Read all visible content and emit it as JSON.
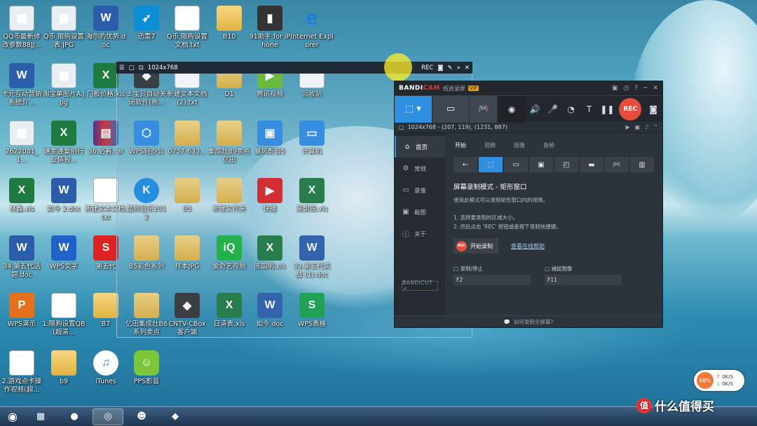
{
  "desktop": {
    "icons": [
      {
        "label": "QQ币最新修改参数88JJ...",
        "kind": "img",
        "glyph": "▦"
      },
      {
        "label": "Q币 限购设置表.JPG",
        "kind": "img",
        "glyph": "▦"
      },
      {
        "label": "海尔的优势.doc",
        "kind": "word",
        "glyph": "W"
      },
      {
        "label": "迅雷7",
        "kind": "bird",
        "glyph": "➶"
      },
      {
        "label": "Q币 限购设置文档.txt",
        "kind": "txt",
        "glyph": ""
      },
      {
        "label": "B10",
        "kind": "folder",
        "glyph": ""
      },
      {
        "label": "91助手 for iPhone",
        "kind": "app",
        "glyph": "▮"
      },
      {
        "label": "Internet Explorer",
        "kind": "ie",
        "glyph": "e"
      },
      {
        "label": "卡元互动营销系统介...",
        "kind": "word",
        "glyph": "W"
      },
      {
        "label": "淘宝单图片A.jpg",
        "kind": "img",
        "glyph": "▦"
      },
      {
        "label": "门板价格.xls",
        "kind": "excel",
        "glyph": "X"
      },
      {
        "label": "3.宝贝自动关闭软件(高...",
        "kind": "app",
        "glyph": "◆"
      },
      {
        "label": "新建文本文档 (2).txt",
        "kind": "txt",
        "glyph": ""
      },
      {
        "label": "D1",
        "kind": "folder",
        "glyph": ""
      },
      {
        "label": "腾讯视频",
        "kind": "green",
        "glyph": "▶"
      },
      {
        "label": "回收站",
        "kind": "txt",
        "glyph": "♻"
      },
      {
        "label": "2622081_1...",
        "kind": "img",
        "glyph": "▦"
      },
      {
        "label": "速卖通案例行业情报...",
        "kind": "excel",
        "glyph": "X"
      },
      {
        "label": "36.必看.rar",
        "kind": "rar",
        "glyph": "▤"
      },
      {
        "label": "WPS轻办公",
        "kind": "blue",
        "glyph": "⬡"
      },
      {
        "label": "0757-633...",
        "kind": "folder",
        "glyph": ""
      },
      {
        "label": "集成灶B9卖点亿田",
        "kind": "folder",
        "glyph": ""
      },
      {
        "label": "暴风影音5",
        "kind": "blue",
        "glyph": "▣"
      },
      {
        "label": "计算机",
        "kind": "blue",
        "glyph": "▭"
      },
      {
        "label": "林鑫.xls",
        "kind": "excel",
        "glyph": "X"
      },
      {
        "label": "如今 2.doc",
        "kind": "word",
        "glyph": "W"
      },
      {
        "label": "新建文本文档.txt",
        "kind": "txt",
        "glyph": ""
      },
      {
        "label": "酷狗音乐2012",
        "kind": "kugou",
        "glyph": "K"
      },
      {
        "label": "B5",
        "kind": "folder",
        "glyph": ""
      },
      {
        "label": "新建文件夹",
        "kind": "folder",
        "glyph": ""
      },
      {
        "label": "快播",
        "kind": "red",
        "glyph": "▶"
      },
      {
        "label": "吴朝锐.xls",
        "kind": "excel",
        "glyph": "X"
      },
      {
        "label": "34.第五代话题.doc",
        "kind": "word",
        "glyph": "W"
      },
      {
        "label": "WPS文字",
        "kind": "wps-w",
        "glyph": "W"
      },
      {
        "label": "第五代",
        "kind": "red",
        "glyph": "S"
      },
      {
        "label": "B5彩色系列",
        "kind": "folder",
        "glyph": ""
      },
      {
        "label": "样本JPG",
        "kind": "folder",
        "glyph": ""
      },
      {
        "label": "爱奇艺视频",
        "kind": "qiyi",
        "glyph": "iQ"
      },
      {
        "label": "陈国明.xls",
        "kind": "excel",
        "glyph": "X"
      },
      {
        "label": "33.第五代实战 (1).doc",
        "kind": "word",
        "glyph": "W"
      },
      {
        "label": "WPS演示",
        "kind": "wps-p",
        "glyph": "P"
      },
      {
        "label": "1.限购设置QB(超清...",
        "kind": "txt",
        "glyph": ""
      },
      {
        "label": "B7",
        "kind": "folder",
        "glyph": ""
      },
      {
        "label": "亿田集成灶B6系列卖点",
        "kind": "folder",
        "glyph": ""
      },
      {
        "label": "CNTV-CBox客户端",
        "kind": "app",
        "glyph": "◆"
      },
      {
        "label": "日清表.xls",
        "kind": "excel",
        "glyph": "X"
      },
      {
        "label": "如今.doc",
        "kind": "word",
        "glyph": "W"
      },
      {
        "label": "WPS表格",
        "kind": "wps-s",
        "glyph": "S"
      },
      {
        "label": "2.游戏点卡操作视频(超...",
        "kind": "txt",
        "glyph": ""
      },
      {
        "label": "b9",
        "kind": "folder",
        "glyph": ""
      },
      {
        "label": "iTunes",
        "kind": "itunes",
        "glyph": "♫"
      },
      {
        "label": "PPS影音",
        "kind": "pps",
        "glyph": "☺"
      }
    ]
  },
  "selection": {
    "size_label": "1024x768",
    "rec_label": "REC"
  },
  "bandicam": {
    "logo_main": "BANDI",
    "logo_accent": "CAM",
    "subtitle": "班迪录屏",
    "vip": "VIP",
    "rec_label": "REC",
    "info": "1024x768 - (207, 119), (1231, 887)",
    "nav": [
      {
        "label": "首页",
        "icon": "⌂"
      },
      {
        "label": "常规",
        "icon": "⚙"
      },
      {
        "label": "录像",
        "icon": "▭"
      },
      {
        "label": "截图",
        "icon": "▣"
      },
      {
        "label": "关于",
        "icon": "ⓘ"
      }
    ],
    "bandicut": "BANDICUT ↗",
    "tabs": [
      "开始",
      "视频",
      "图像",
      "音频"
    ],
    "heading": "屏幕录制模式 - 矩形窗口",
    "desc": "使用此模式可以录制矩形窗口内的视频。",
    "step1": "1. 选择要录制的区域大小。",
    "step2": "2. 然后点击 'REC' 按钮或者按下录制快捷键。",
    "start_rec": "开始录制",
    "start_rec_icon": "REC",
    "help_link": "查看在线帮助",
    "hotkey_rec_label": "录制/停止",
    "hotkey_rec_value": "F2",
    "hotkey_cap_label": "捕捉图像",
    "hotkey_cap_value": "F11",
    "footer": "如何录制全屏幕?"
  },
  "speed": {
    "percent": "68%",
    "up": "0K/S",
    "down": "0K/S"
  },
  "watermark": "什么值得买",
  "watermark_icon": "值"
}
